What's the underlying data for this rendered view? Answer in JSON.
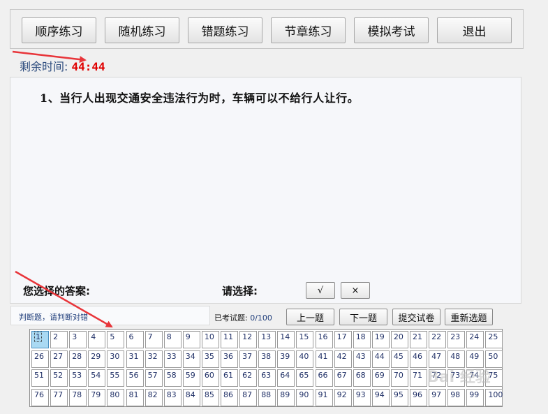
{
  "nav": {
    "buttons": [
      "顺序练习",
      "随机练习",
      "错题练习",
      "节章练习",
      "模拟考试",
      "退出"
    ]
  },
  "timer": {
    "label": "剩余时间:",
    "value": "44:44"
  },
  "question": {
    "text": "1、当行人出现交通安全违法行为时，车辆可以不给行人让行。"
  },
  "answer": {
    "selected_label": "您选择的答案:",
    "choose_label": "请选择:",
    "true_symbol": "√",
    "false_symbol": "×"
  },
  "hint": {
    "text": "判断题，请判断对错"
  },
  "progress": {
    "label": "已考试题:",
    "count": "0/100"
  },
  "actions": [
    "上一题",
    "下一题",
    "提交试卷",
    "重新选题"
  ],
  "grid": {
    "total": 100,
    "columns": 25,
    "current": 1
  },
  "colors": {
    "timer_value": "#e00000",
    "current_cell": "#a9d9f3",
    "arrow": "#e8353a",
    "label_blue": "#1f3d7a"
  },
  "watermark": {
    "text": "Bai 经验"
  }
}
